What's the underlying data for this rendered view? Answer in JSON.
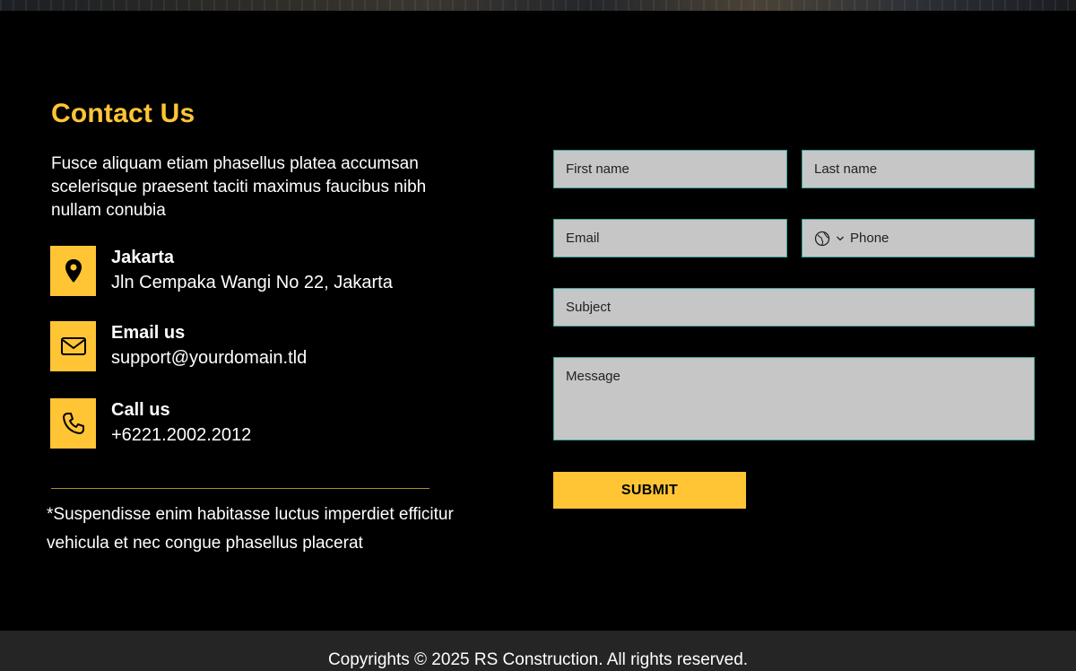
{
  "contact": {
    "title": "Contact Us",
    "description": "Fusce aliquam etiam phasellus platea accumsan scelerisque praesent taciti maximus faucibus nibh nullam conubia",
    "items": [
      {
        "icon": "location-pin-icon",
        "title": "Jakarta",
        "value": "Jln Cempaka Wangi No 22, Jakarta"
      },
      {
        "icon": "envelope-icon",
        "title": "Email us",
        "value": "support@yourdomain.tld"
      },
      {
        "icon": "phone-icon",
        "title": "Call us",
        "value": "+6221.2002.2012"
      }
    ],
    "footnote": "*Suspendisse enim habitasse luctus imperdiet efficitur vehicula et nec congue phasellus placerat"
  },
  "form": {
    "first_name_placeholder": "First name",
    "last_name_placeholder": "Last name",
    "email_placeholder": "Email",
    "phone_placeholder": "Phone",
    "subject_placeholder": "Subject",
    "message_placeholder": "Message",
    "submit_label": "SUBMIT"
  },
  "footer": {
    "copyright": "Copyrights © 2025 RS Construction. All rights reserved."
  },
  "colors": {
    "accent": "#ffc535",
    "background": "#000000",
    "field_bg": "#c6c6c6",
    "field_border": "#3ba89e",
    "footer_bg": "#252525"
  }
}
